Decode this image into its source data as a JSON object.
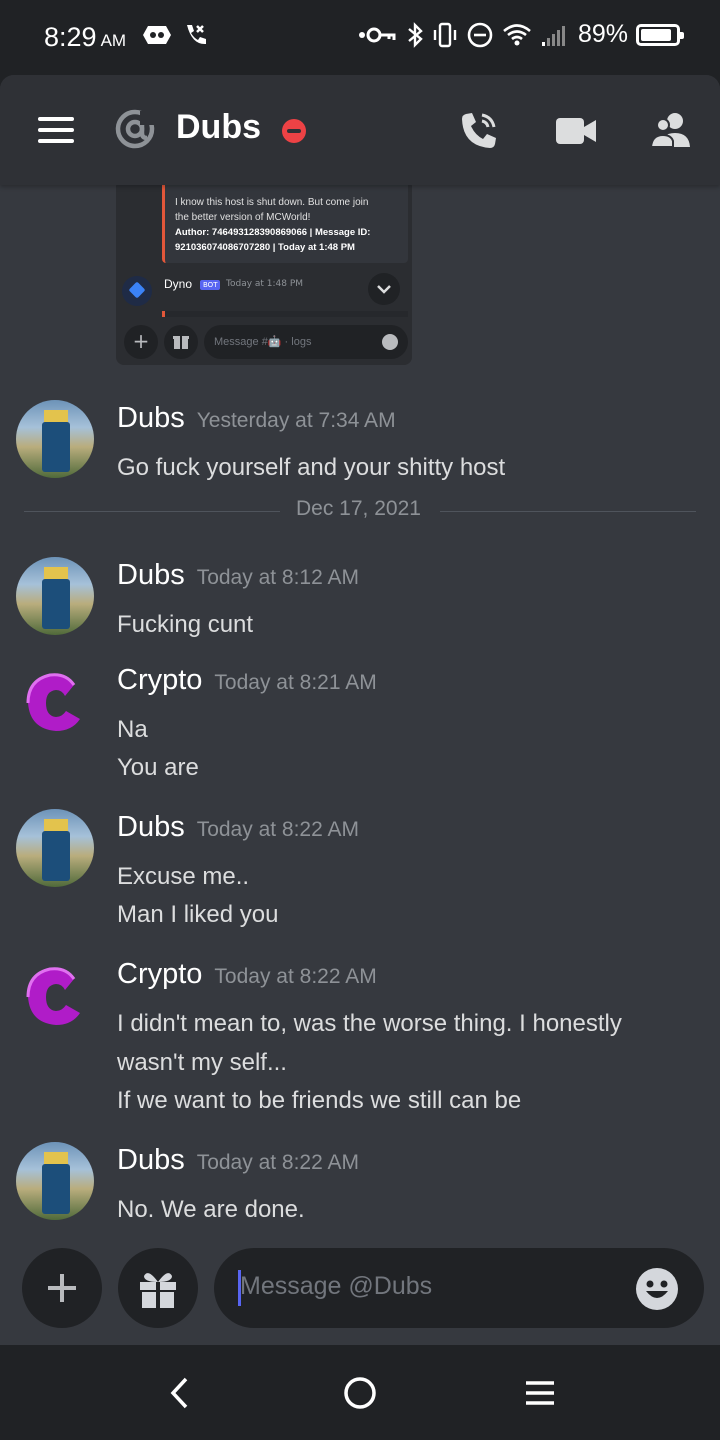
{
  "status_bar": {
    "time": "8:29",
    "ampm": "AM",
    "battery": "89%",
    "battery_level": 0.89
  },
  "header": {
    "title": "Dubs",
    "status": "do-not-disturb"
  },
  "embed": {
    "text_line1": "I know this host is shut down. But come join",
    "text_line2": "the better version of MCWorld!",
    "author_line1": "Author: 746493128390869066 | Message ID:",
    "author_line2": "921036074086707280 | Today at 1:48 PM",
    "bot_name": "Dyno",
    "bot_tag": "BOT",
    "bot_time": "Today at 1:48 PM",
    "input_placeholder": "Message #🤖 · logs"
  },
  "messages": [
    {
      "author": "Dubs",
      "time": "Yesterday at 7:34 AM",
      "lines": [
        "Go fuck yourself and your shitty host"
      ]
    },
    {
      "author": "Dubs",
      "time": "Today at 8:12 AM",
      "lines": [
        "Fucking cunt"
      ]
    },
    {
      "author": "Crypto",
      "time": "Today at 8:21 AM",
      "lines": [
        "Na",
        "You are"
      ]
    },
    {
      "author": "Dubs",
      "time": "Today at 8:22 AM",
      "lines": [
        "Excuse me..",
        "Man I liked you"
      ]
    },
    {
      "author": "Crypto",
      "time": "Today at 8:22 AM",
      "lines": [
        "I didn't mean to, was the worse thing. I honestly",
        "wasn't my self...",
        "If we want to be friends we still can be"
      ]
    },
    {
      "author": "Dubs",
      "time": "Today at 8:22 AM",
      "lines": [
        "No. We are done."
      ]
    }
  ],
  "date_divider": "Dec 17, 2021",
  "composer": {
    "placeholder": "Message @Dubs"
  },
  "colors": {
    "background": "#36393f",
    "header": "#2f3136",
    "dnd_red": "#ed4245",
    "blurple": "#5865f2",
    "crypto_purple": "#b01cc8"
  },
  "icons": [
    "hamburger-menu-icon",
    "at-icon",
    "voice-call-icon",
    "video-call-icon",
    "members-icon",
    "plus-icon",
    "gift-icon",
    "emoji-icon",
    "back-icon",
    "home-icon",
    "recents-icon"
  ]
}
